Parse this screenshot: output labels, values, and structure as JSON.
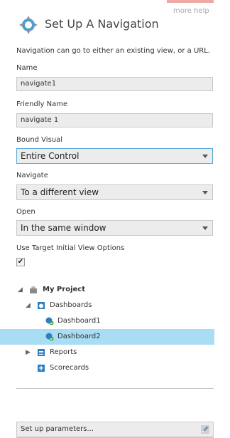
{
  "header": {
    "more_help": "more help",
    "title": "Set Up A Navigation"
  },
  "description": "Navigation can go to either an existing view, or a URL.",
  "fields": {
    "name_label": "Name",
    "name_value": "navigate1",
    "friendly_label": "Friendly Name",
    "friendly_value": "navigate 1",
    "bound_label": "Bound Visual",
    "bound_value": "Entire Control",
    "navigate_label": "Navigate",
    "navigate_value": "To a different view",
    "open_label": "Open",
    "open_value": "In the same window",
    "target_label": "Use Target Initial View Options",
    "target_checked": "✔"
  },
  "tree": {
    "root": {
      "toggle": "◢",
      "label": "My Project"
    },
    "dashboards": {
      "toggle": "◢",
      "label": "Dashboards"
    },
    "dashboard1": {
      "label": "Dashboard1"
    },
    "dashboard2": {
      "label": "Dashboard2"
    },
    "reports": {
      "toggle": "▶",
      "label": "Reports"
    },
    "scorecards": {
      "label": "Scorecards"
    }
  },
  "params_button": "Set up parameters...",
  "colors": {
    "accent": "#5aa9d6",
    "selected_row": "#a8ddf3",
    "close_tab": "#f0a8a4"
  }
}
